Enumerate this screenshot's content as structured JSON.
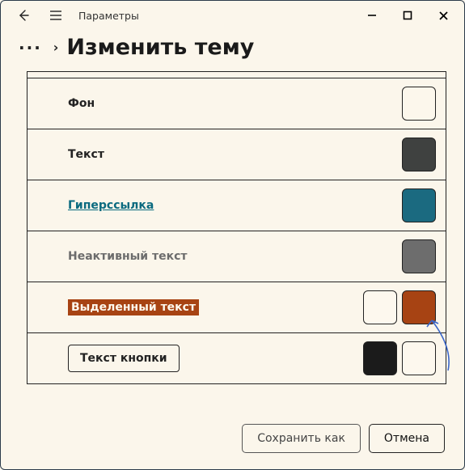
{
  "titlebar": {
    "title": "Параметры"
  },
  "breadcrumb": {
    "page_title": "Изменить тему"
  },
  "rows": {
    "background": {
      "label": "Фон",
      "swatch": "#fcf7ec"
    },
    "text": {
      "label": "Текст",
      "swatch": "#3f4140"
    },
    "hyperlink": {
      "label": "Гиперссылка",
      "swatch": "#1b6a80"
    },
    "inactive": {
      "label": "Неактивный текст",
      "swatch": "#6d6d6d"
    },
    "highlighted": {
      "label": "Выделенный текст",
      "swatch_fg": "#fdf8ee",
      "swatch_bg": "#a74313"
    },
    "button": {
      "label": "Текст кнопки",
      "swatch_fg": "#1b1b1b",
      "swatch_bg": "#fdf8ee"
    }
  },
  "footer": {
    "save_as": "Сохранить как",
    "cancel": "Отмена"
  }
}
